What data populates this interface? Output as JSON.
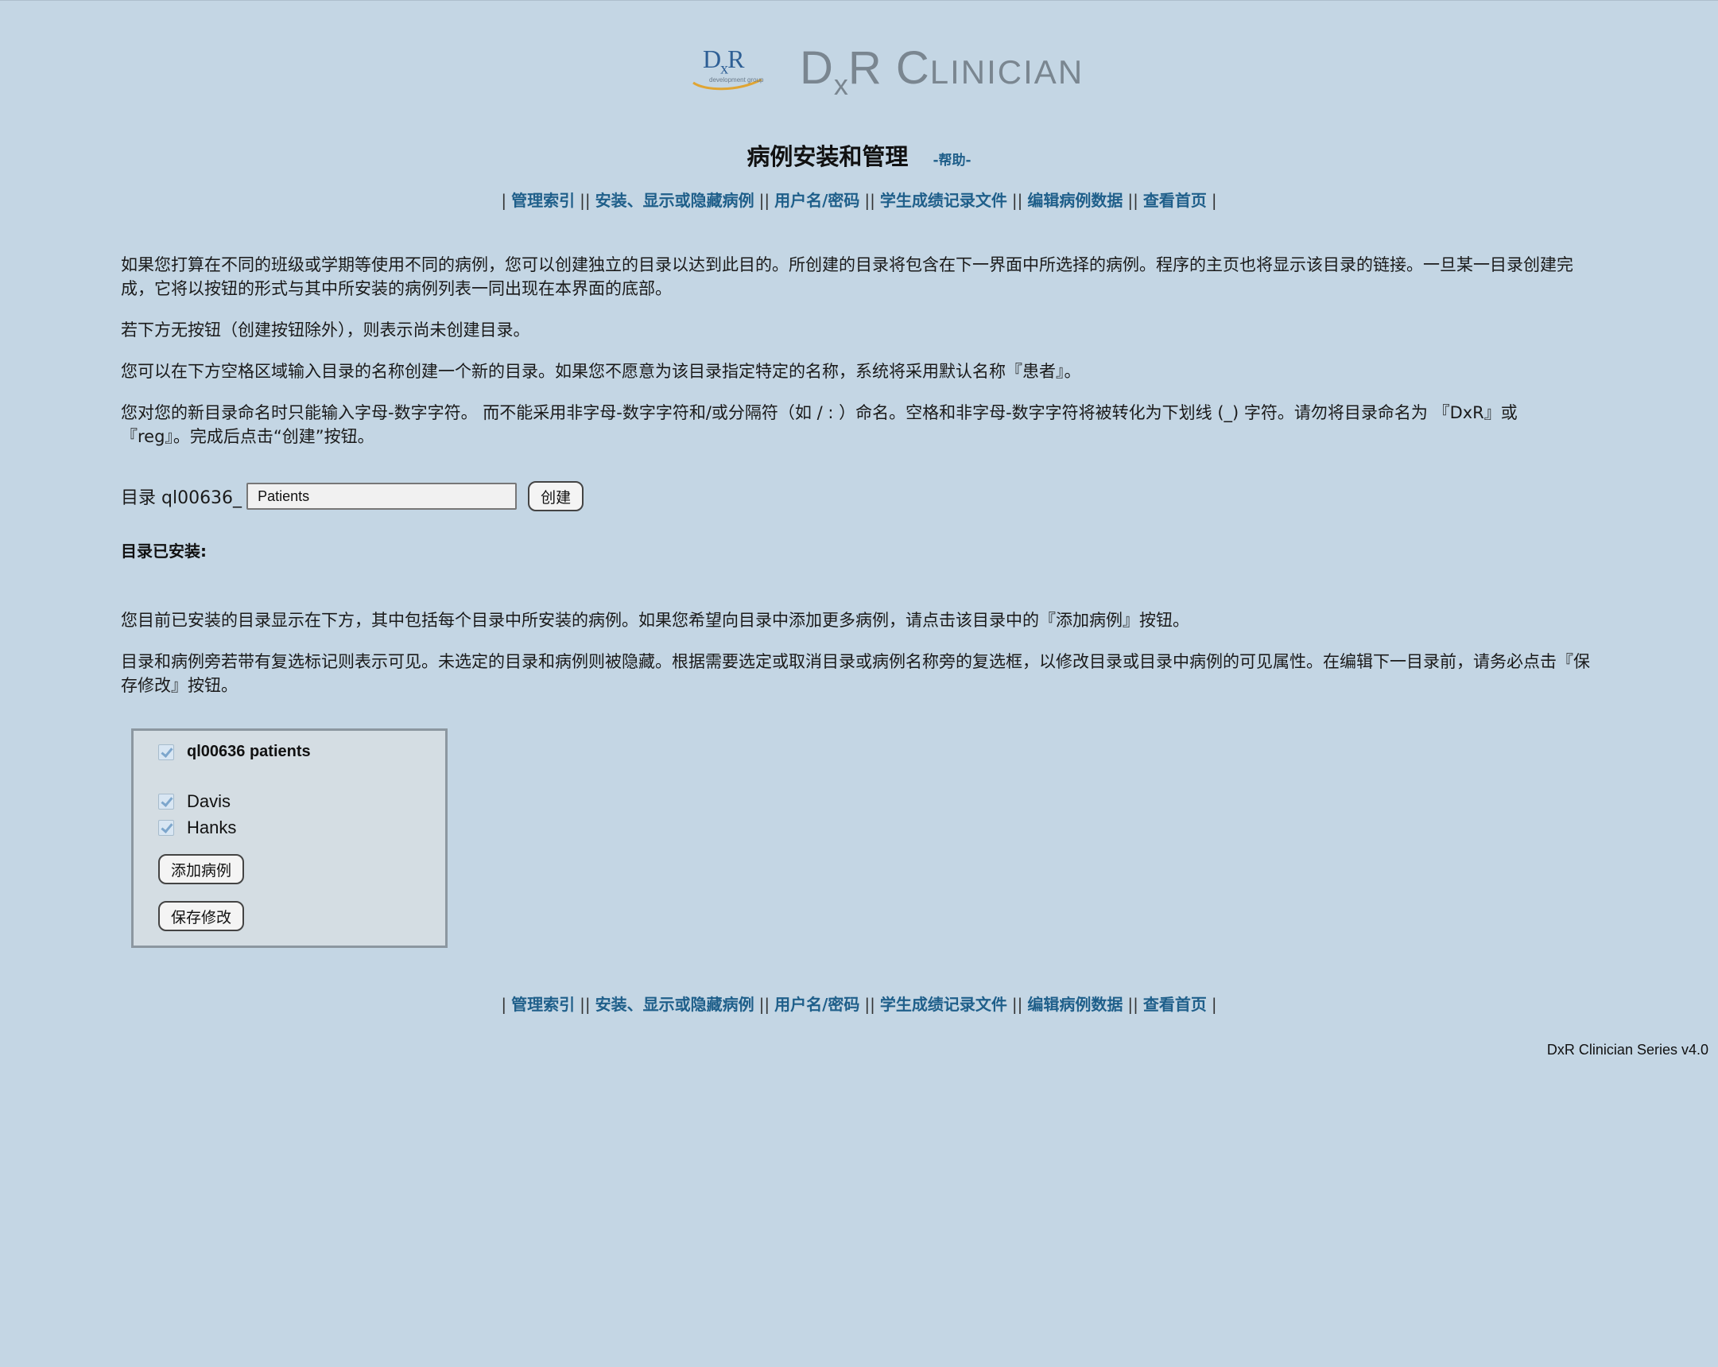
{
  "header": {
    "small_logo_text": "DxR",
    "small_logo_sub": "development group",
    "brand": "DxR Clinician"
  },
  "page": {
    "title": "病例安装和管理",
    "help": "-帮助-"
  },
  "nav": {
    "items": [
      "管理索引",
      "安装、显示或隐藏病例",
      "用户名/密码",
      "学生成绩记录文件",
      "编辑病例数据",
      "查看首页"
    ]
  },
  "intro": {
    "p1": "如果您打算在不同的班级或学期等使用不同的病例，您可以创建独立的目录以达到此目的。所创建的目录将包含在下一界面中所选择的病例。程序的主页也将显示该目录的链接。一旦某一目录创建完成，它将以按钮的形式与其中所安装的病例列表一同出现在本界面的底部。",
    "p2": "若下方无按钮（创建按钮除外），则表示尚未创建目录。",
    "p3": "您可以在下方空格区域输入目录的名称创建一个新的目录。如果您不愿意为该目录指定特定的名称，系统将采用默认名称『患者』。",
    "p4": "您对您的新目录命名时只能输入字母-数字字符。 而不能采用非字母-数字字符和/或分隔符（如 / : ）命名。空格和非字母-数字字符将被转化为下划线 (_) 字符。请勿将目录命名为 『DxR』或 『reg』。完成后点击“创建”按钮。"
  },
  "form": {
    "label": "目录 ql00636_",
    "input_value": "Patients",
    "create_button": "创建"
  },
  "installed": {
    "heading": "目录已安装:",
    "p1": "您目前已安装的目录显示在下方，其中包括每个目录中所安装的病例。如果您希望向目录中添加更多病例，请点击该目录中的『添加病例』按钮。",
    "p2": "目录和病例旁若带有复选标记则表示可见。未选定的目录和病例则被隐藏。根据需要选定或取消目录或病例名称旁的复选框，以修改目录或目录中病例的可见属性。在编辑下一目录前，请务必点击『保存修改』按钮。"
  },
  "directory": {
    "name": "ql00636 patients",
    "checked": true,
    "cases": [
      {
        "name": "Davis",
        "checked": true
      },
      {
        "name": "Hanks",
        "checked": true
      }
    ],
    "add_button": "添加病例",
    "save_button": "保存修改"
  },
  "footer": {
    "version": "DxR Clinician Series v4.0"
  },
  "colors": {
    "background": "#c4d6e4",
    "link": "#1f5f8a"
  }
}
